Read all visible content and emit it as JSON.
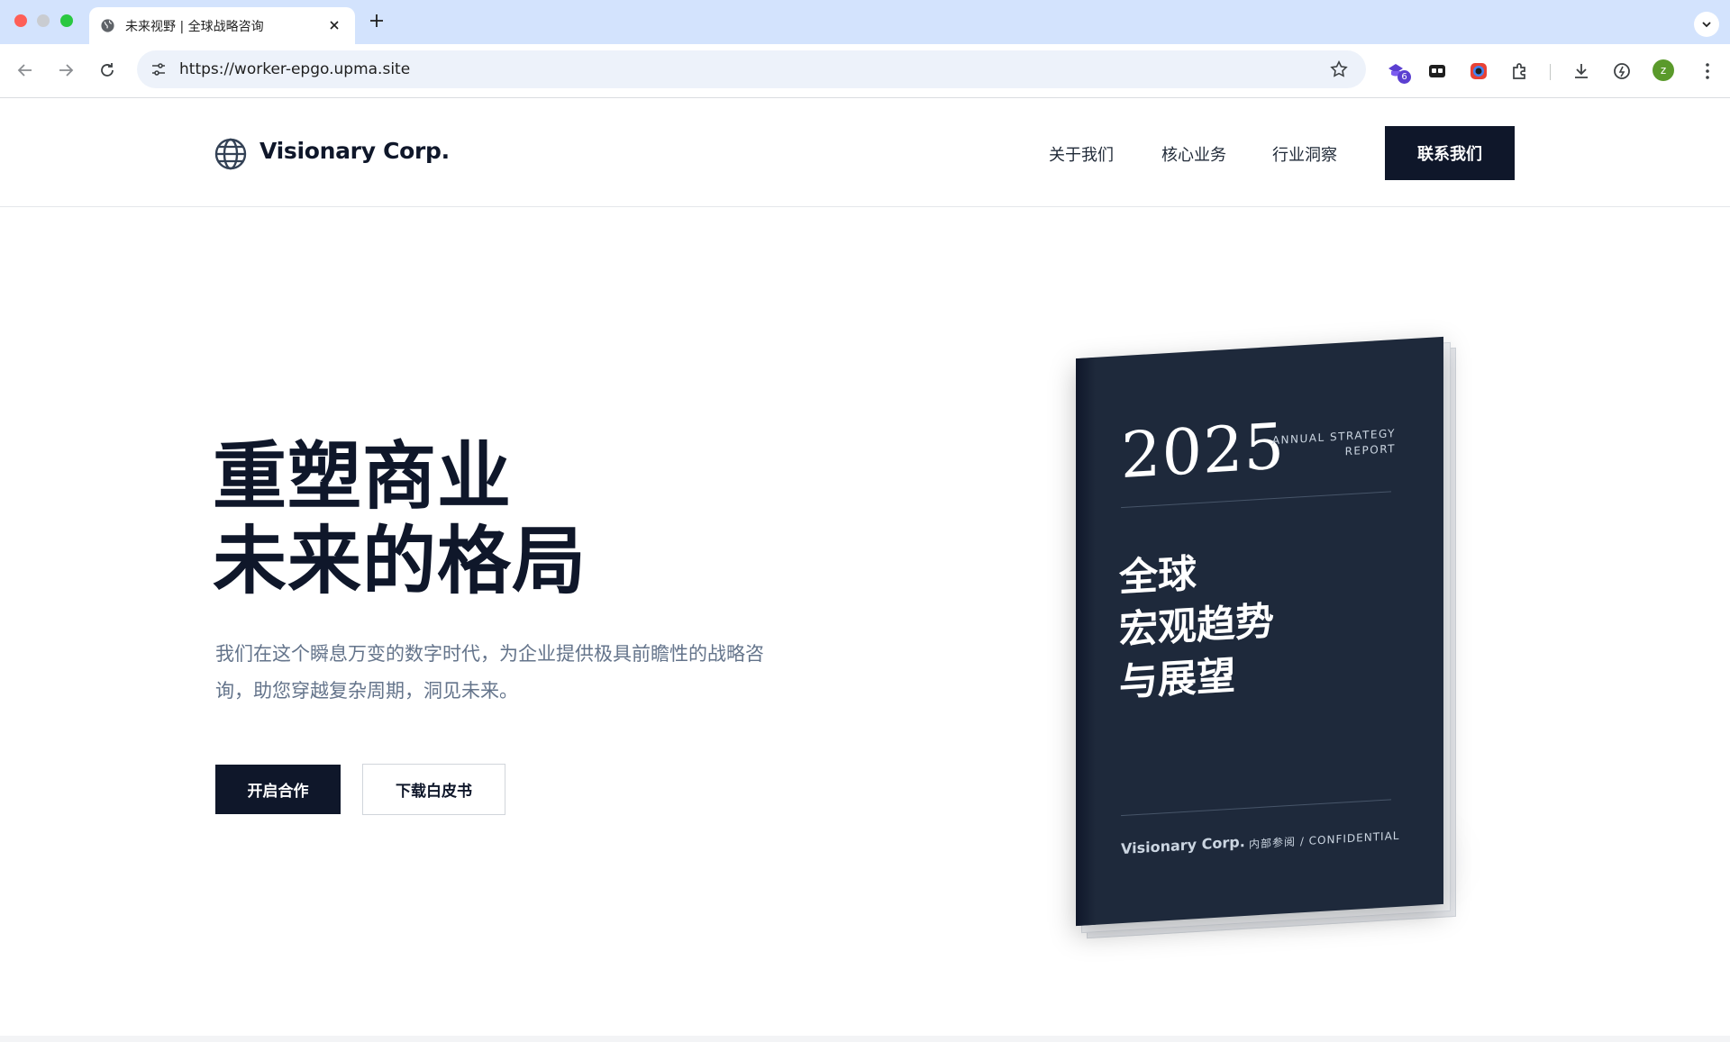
{
  "browser": {
    "tab": {
      "title": "未来视野 | 全球战略咨询"
    },
    "address_bar": {
      "url": "https://worker-epgo.upma.site"
    },
    "extensions": {
      "badge_count": "6"
    },
    "profile": {
      "initial": "z"
    }
  },
  "header": {
    "logo_text": "Visionary Corp.",
    "nav": [
      {
        "label": "关于我们"
      },
      {
        "label": "核心业务"
      },
      {
        "label": "行业洞察"
      }
    ],
    "cta_label": "联系我们"
  },
  "hero": {
    "title_line1": "重塑商业",
    "title_line2": "未来的格局",
    "description": "我们在这个瞬息万变的数字时代，为企业提供极具前瞻性的战略咨询，助您穿越复杂周期，洞见未来。",
    "primary_button": "开启合作",
    "secondary_button": "下载白皮书"
  },
  "book": {
    "year": "2025",
    "tag_line1": "ANNUAL STRATEGY",
    "tag_line2": "REPORT",
    "heading_line1": "全球",
    "heading_line2": "宏观趋势",
    "heading_line3": "与展望",
    "brand": "Visionary Corp.",
    "confidential": "内部参阅 / CONFIDENTIAL"
  },
  "colors": {
    "brand_dark": "#0f172a",
    "cover": "#1e293b",
    "muted_text": "#64748b",
    "chrome_tabstrip": "#d3e3fd"
  }
}
